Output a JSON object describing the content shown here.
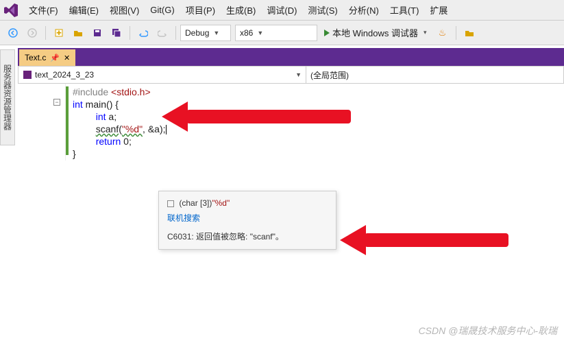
{
  "menu": {
    "items": [
      "文件(F)",
      "编辑(E)",
      "视图(V)",
      "Git(G)",
      "项目(P)",
      "生成(B)",
      "调试(D)",
      "测试(S)",
      "分析(N)",
      "工具(T)",
      "扩展"
    ]
  },
  "toolbar": {
    "config": "Debug",
    "platform": "x86",
    "run_label": "本地 Windows 调试器"
  },
  "side_tab": "服务器资源管理器",
  "file_tab": {
    "name": "Text.c"
  },
  "nav": {
    "left": "text_2024_3_23",
    "right": "(全局范围)"
  },
  "code": {
    "l1_pp": "#include ",
    "l1_inc": "<stdio.h>",
    "l2_kw": "int",
    "l2_rest": " main() {",
    "l3_kw": "int",
    "l3_rest": " a;",
    "l4_fn": "scanf",
    "l4_open": "(",
    "l4_str": "\"%d\"",
    "l4_rest": ", &a);",
    "l5_kw": "return",
    "l5_rest": " 0;",
    "l6": "}"
  },
  "tooltip": {
    "sig_prefix": "(char [3])",
    "sig_str": "\"%d\"",
    "link": "联机搜索",
    "msg": "C6031: 返回值被忽略: \"scanf\"。"
  },
  "watermark": "CSDN @瑞晟技术服务中心-耿瑞"
}
